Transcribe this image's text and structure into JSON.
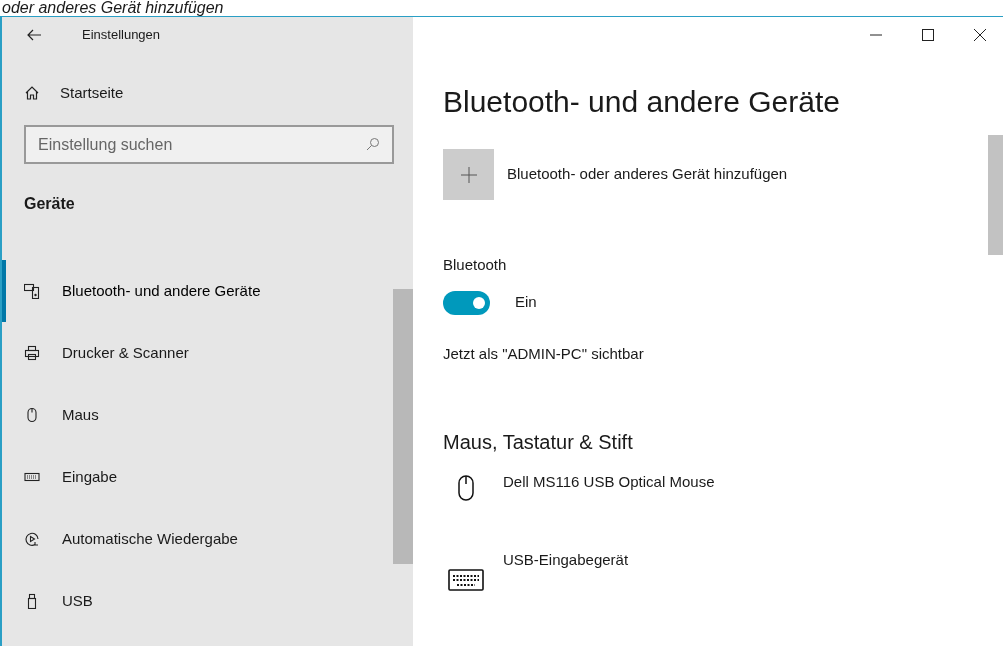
{
  "caption": "oder anderes Gerät hinzufügen",
  "window": {
    "title": "Einstellungen"
  },
  "sidebar": {
    "home": "Startseite",
    "search": {
      "placeholder": "Einstellung suchen"
    },
    "section": "Geräte",
    "items": [
      {
        "label": "Bluetooth- und andere Geräte",
        "kind": "devices",
        "selected": true
      },
      {
        "label": "Drucker & Scanner",
        "kind": "printer",
        "selected": false
      },
      {
        "label": "Maus",
        "kind": "mouse",
        "selected": false
      },
      {
        "label": "Eingabe",
        "kind": "keyboard",
        "selected": false
      },
      {
        "label": "Automatische Wiedergabe",
        "kind": "autoplay",
        "selected": false
      },
      {
        "label": "USB",
        "kind": "usb",
        "selected": false
      }
    ]
  },
  "main": {
    "title": "Bluetooth- und andere Geräte",
    "add_device": "Bluetooth- oder anderes Gerät hinzufügen",
    "bluetooth": {
      "label": "Bluetooth",
      "on": true,
      "state_text": "Ein"
    },
    "visibility": "Jetzt als \"ADMIN-PC\" sichtbar",
    "section": "Maus, Tastatur & Stift",
    "devices": [
      {
        "name": "Dell MS116 USB Optical Mouse",
        "kind": "mouse"
      },
      {
        "name": "USB-Eingabegerät",
        "kind": "keyboard"
      }
    ]
  }
}
